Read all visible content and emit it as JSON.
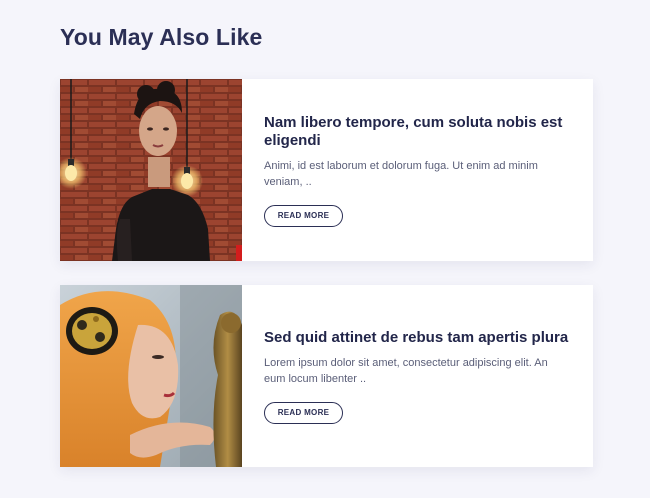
{
  "section": {
    "title": "You May Also Like"
  },
  "cards": [
    {
      "title": "Nam libero tempore, cum soluta nobis est eligendi",
      "excerpt": "Animi, id est laborum et dolorum fuga. Ut enim ad minim veniam, ..",
      "button_label": "READ MORE",
      "image_semantic": "woman-with-light-bulbs-brick-wall-photo"
    },
    {
      "title": "Sed quid attinet de rebus tam apertis plura",
      "excerpt": "Lorem ipsum dolor sit amet, consectetur adipiscing elit. An eum locum libenter ..",
      "button_label": "READ MORE",
      "image_semantic": "woman-in-orange-headscarf-with-brooch-photo"
    }
  ],
  "colors": {
    "page_background": "#f5f5fb",
    "card_background": "#ffffff",
    "heading": "#2b2f55",
    "body_text": "#5a5e78"
  }
}
